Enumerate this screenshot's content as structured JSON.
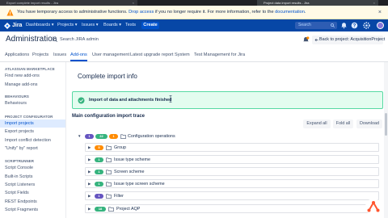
{
  "browser": {
    "tabs": [
      {
        "title": "Export complete import results - Jira"
      },
      {
        "title": "Project data import results - Jira"
      }
    ],
    "close_glyph": "×"
  },
  "banner": {
    "text": "You have temporary access to administrative functions.",
    "link1": "Drop access",
    "text2": "if you no longer require it. For more information, refer to the",
    "link2": "documentation",
    "text3": ".",
    "close_glyph": "×",
    "icon": "warning-icon"
  },
  "navbar": {
    "logo": "Jira",
    "items": [
      "Dashboards ▾",
      "Projects ▾",
      "Issues ▾",
      "Boards ▾",
      "Tests"
    ],
    "create_label": "Create",
    "search_placeholder": "Search",
    "icons": [
      "search-icon",
      "notifications-icon",
      "help-icon",
      "settings-icon",
      "avatar"
    ],
    "accent": "#0747a6"
  },
  "header": {
    "title": "Administration",
    "search_label": "Search JIRA admin",
    "back_button": "Back to project: AcquisitionProject"
  },
  "admin_tabs": {
    "items": [
      "Applications",
      "Projects",
      "Issues",
      "Add-ons",
      "User management",
      "Latest upgrade report",
      "System",
      "Test Management for Jira"
    ],
    "active": "Add-ons"
  },
  "sidebar": {
    "sections": [
      {
        "heading": "ATLASSIAN MARKETPLACE",
        "items": [
          "Find new add-ons",
          "Manage add-ons"
        ]
      },
      {
        "heading": "BEHAVIOURS",
        "items": [
          "Behaviours"
        ]
      },
      {
        "heading": "PROJECT CONFIGURATOR",
        "items": [
          "Import projects",
          "Export projects",
          "Import conflict detection",
          "\"Unify\" by\" report"
        ]
      },
      {
        "heading": "SCRIPTRUNNER",
        "items": [
          "Script Console",
          "Built-in Scripts",
          "Script Listeners",
          "Script Fields",
          "REST Endpoints",
          "Script Fragments"
        ]
      }
    ],
    "active_item": "Import projects"
  },
  "main": {
    "title": "Complete import info",
    "success_message": "Import of data and attachments finished",
    "trace_title": "Main configuration import trace",
    "buttons": [
      "Expand all",
      "Fold all",
      "Download"
    ],
    "root": {
      "badges": [
        "1",
        "22",
        "1"
      ],
      "label": "Configuration operations"
    },
    "rows": [
      {
        "badges": [
          {
            "text": "5",
            "color": "orange"
          }
        ],
        "label": "Group"
      },
      {
        "badges": [
          {
            "text": "1",
            "color": "green"
          }
        ],
        "label": "Issue type scheme"
      },
      {
        "badges": [
          {
            "text": "1",
            "color": "green"
          }
        ],
        "label": "Screen scheme"
      },
      {
        "badges": [
          {
            "text": "1",
            "color": "green"
          }
        ],
        "label": "Issue type screen scheme"
      },
      {
        "badges": [
          {
            "text": "1",
            "color": "purple"
          }
        ],
        "label": "Filter"
      },
      {
        "badges": [
          {
            "text": "18",
            "color": "green"
          }
        ],
        "label": "Project AQP"
      }
    ]
  },
  "colors": {
    "success": "#36b37e",
    "warning": "#ff8b00",
    "info": "#6554c0",
    "link": "#0052cc"
  }
}
